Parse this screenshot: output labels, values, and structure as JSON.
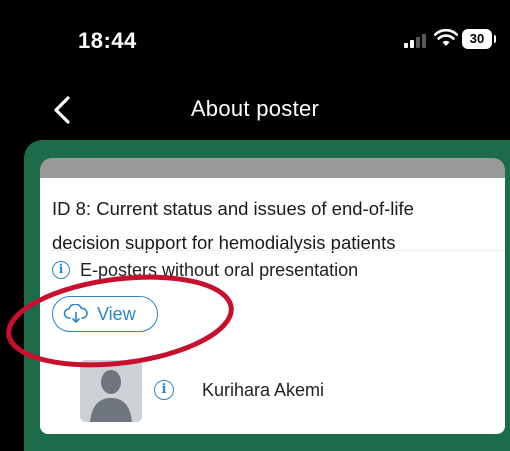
{
  "status_bar": {
    "time": "18:44",
    "battery_level": "30",
    "icons": [
      "signal-icon",
      "wifi-icon",
      "battery-icon"
    ]
  },
  "nav": {
    "back_icon": "chevron-left-icon",
    "title": "About poster"
  },
  "poster": {
    "title": "ID 8: Current status and issues of end-of-life decision support for hemodialysis patients",
    "category_icon": "info-icon",
    "category": "E-posters without oral presentation",
    "view_button": {
      "icon": "cloud-download-icon",
      "label": "View"
    },
    "author": {
      "avatar": "default-avatar",
      "info_icon": "info-icon",
      "name": "Kurihara Akemi"
    }
  },
  "colors": {
    "background": "#000000",
    "content_green": "#1c6b4a",
    "card_strip": "#9a9a9a",
    "accent_blue": "#2a86c8",
    "highlight_red": "#c8102e"
  }
}
